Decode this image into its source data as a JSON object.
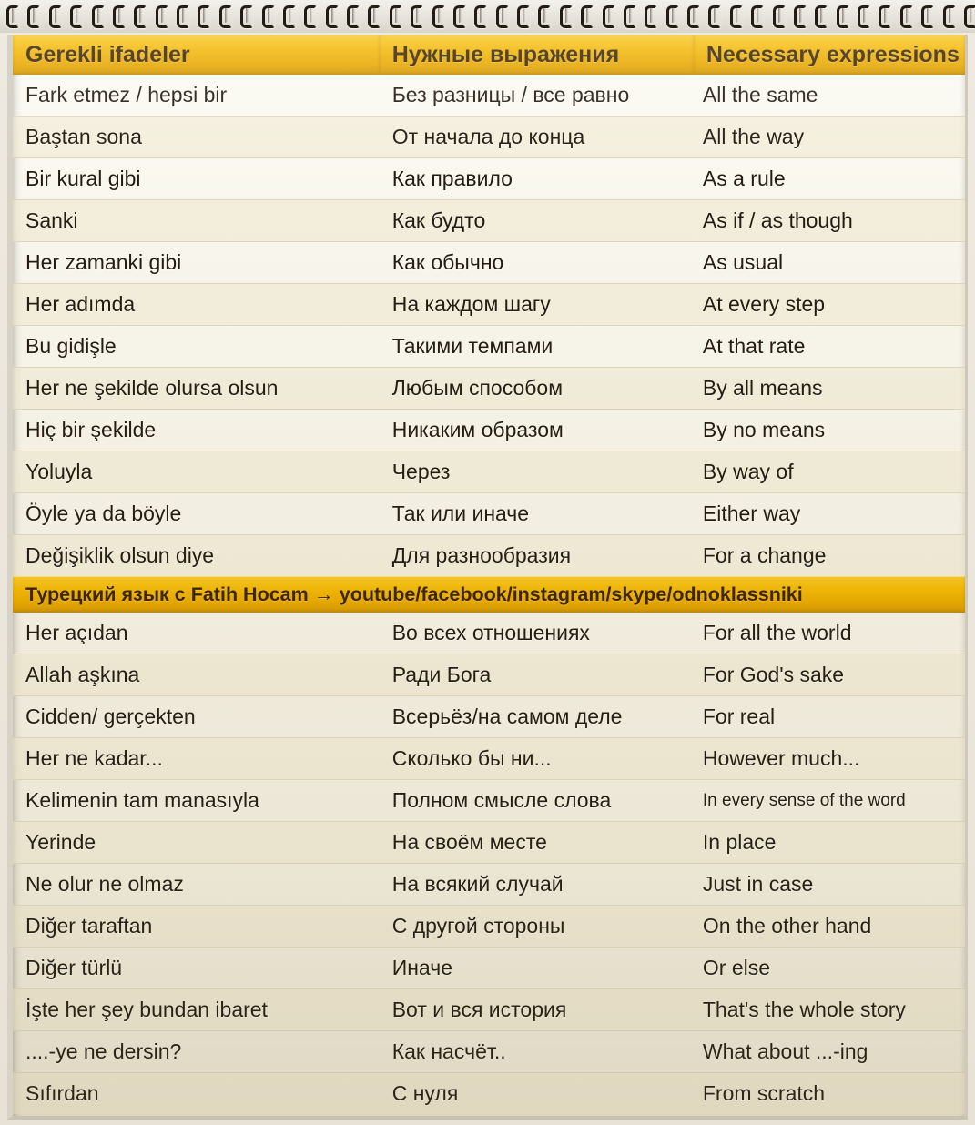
{
  "sheet": {
    "binding_ring_count": 46,
    "colors": {
      "header_gold": "#f2b705",
      "header_text": "#3b2408",
      "paper": "#faf8ef",
      "row_alt": "#eee8ce",
      "row_line": "#ded7bf",
      "body_text": "#241c12"
    }
  },
  "header": {
    "col_turkish": "Gerekli ifadeler",
    "col_russian": "Нужные выражения",
    "col_english": "Necessary expressions"
  },
  "banner": {
    "title": "Турецкий язык с Fatih Hocam",
    "arrow": "→",
    "links": "youtube/facebook/instagram/skype/odnoklassniki"
  },
  "rows_top": [
    {
      "tr": "Fark etmez / hepsi bir",
      "ru": "Без разницы / все равно",
      "en": "All the same"
    },
    {
      "tr": "Baştan sona",
      "ru": "От начала до конца",
      "en": "All the way"
    },
    {
      "tr": "Bir kural gibi",
      "ru": "Как правило",
      "en": "As a rule"
    },
    {
      "tr": "Sanki",
      "ru": "Как будто",
      "en": "As if / as though"
    },
    {
      "tr": "Her zamanki gibi",
      "ru": "Как обычно",
      "en": "As usual"
    },
    {
      "tr": "Her adımda",
      "ru": "На каждом шагу",
      "en": "At every step"
    },
    {
      "tr": "Bu gidişle",
      "ru": "Такими темпами",
      "en": "At that rate"
    },
    {
      "tr": "Her ne şekilde olursa olsun",
      "ru": "Любым способом",
      "en": "By all means"
    },
    {
      "tr": "Hiç bir şekilde",
      "ru": "Никаким образом",
      "en": "By no means"
    },
    {
      "tr": "Yoluyla",
      "ru": "Через",
      "en": "By way of"
    },
    {
      "tr": "Öyle ya da böyle",
      "ru": "Так или иначе",
      "en": "Either way"
    },
    {
      "tr": "Değişiklik olsun diye",
      "ru": "Для разнообразия",
      "en": "For a change"
    }
  ],
  "rows_bottom": [
    {
      "tr": "Her açıdan",
      "ru": "Во всех отношениях",
      "en": "For all the world"
    },
    {
      "tr": "Allah aşkına",
      "ru": "Ради Бога",
      "en": "For God's sake"
    },
    {
      "tr": "Cidden/ gerçekten",
      "ru": "Всерьёз/на самом деле",
      "en": "For real"
    },
    {
      "tr": "Her ne kadar...",
      "ru": "Сколько бы ни...",
      "en": "However much..."
    },
    {
      "tr": "Kelimenin tam manasıyla",
      "ru": "Полном смысле слова",
      "en": "In every sense of the word",
      "en_small": true
    },
    {
      "tr": "Yerinde",
      "ru": "На своём месте",
      "en": "In place"
    },
    {
      "tr": "Ne olur ne olmaz",
      "ru": "На всякий случай",
      "en": "Just in case"
    },
    {
      "tr": "Diğer taraftan",
      "ru": "С другой стороны",
      "en": "On the other hand"
    },
    {
      "tr": "Diğer türlü",
      "ru": "Иначе",
      "en": "Or else"
    },
    {
      "tr": "İşte her şey bundan ibaret",
      "ru": "Вот и вся история",
      "en": "That's the whole story"
    },
    {
      "tr": "....-ye ne dersin?",
      "ru": "Как насчёт..",
      "en": "What about ...-ing"
    },
    {
      "tr": "Sıfırdan",
      "ru": "С нуля",
      "en": "From scratch"
    }
  ]
}
